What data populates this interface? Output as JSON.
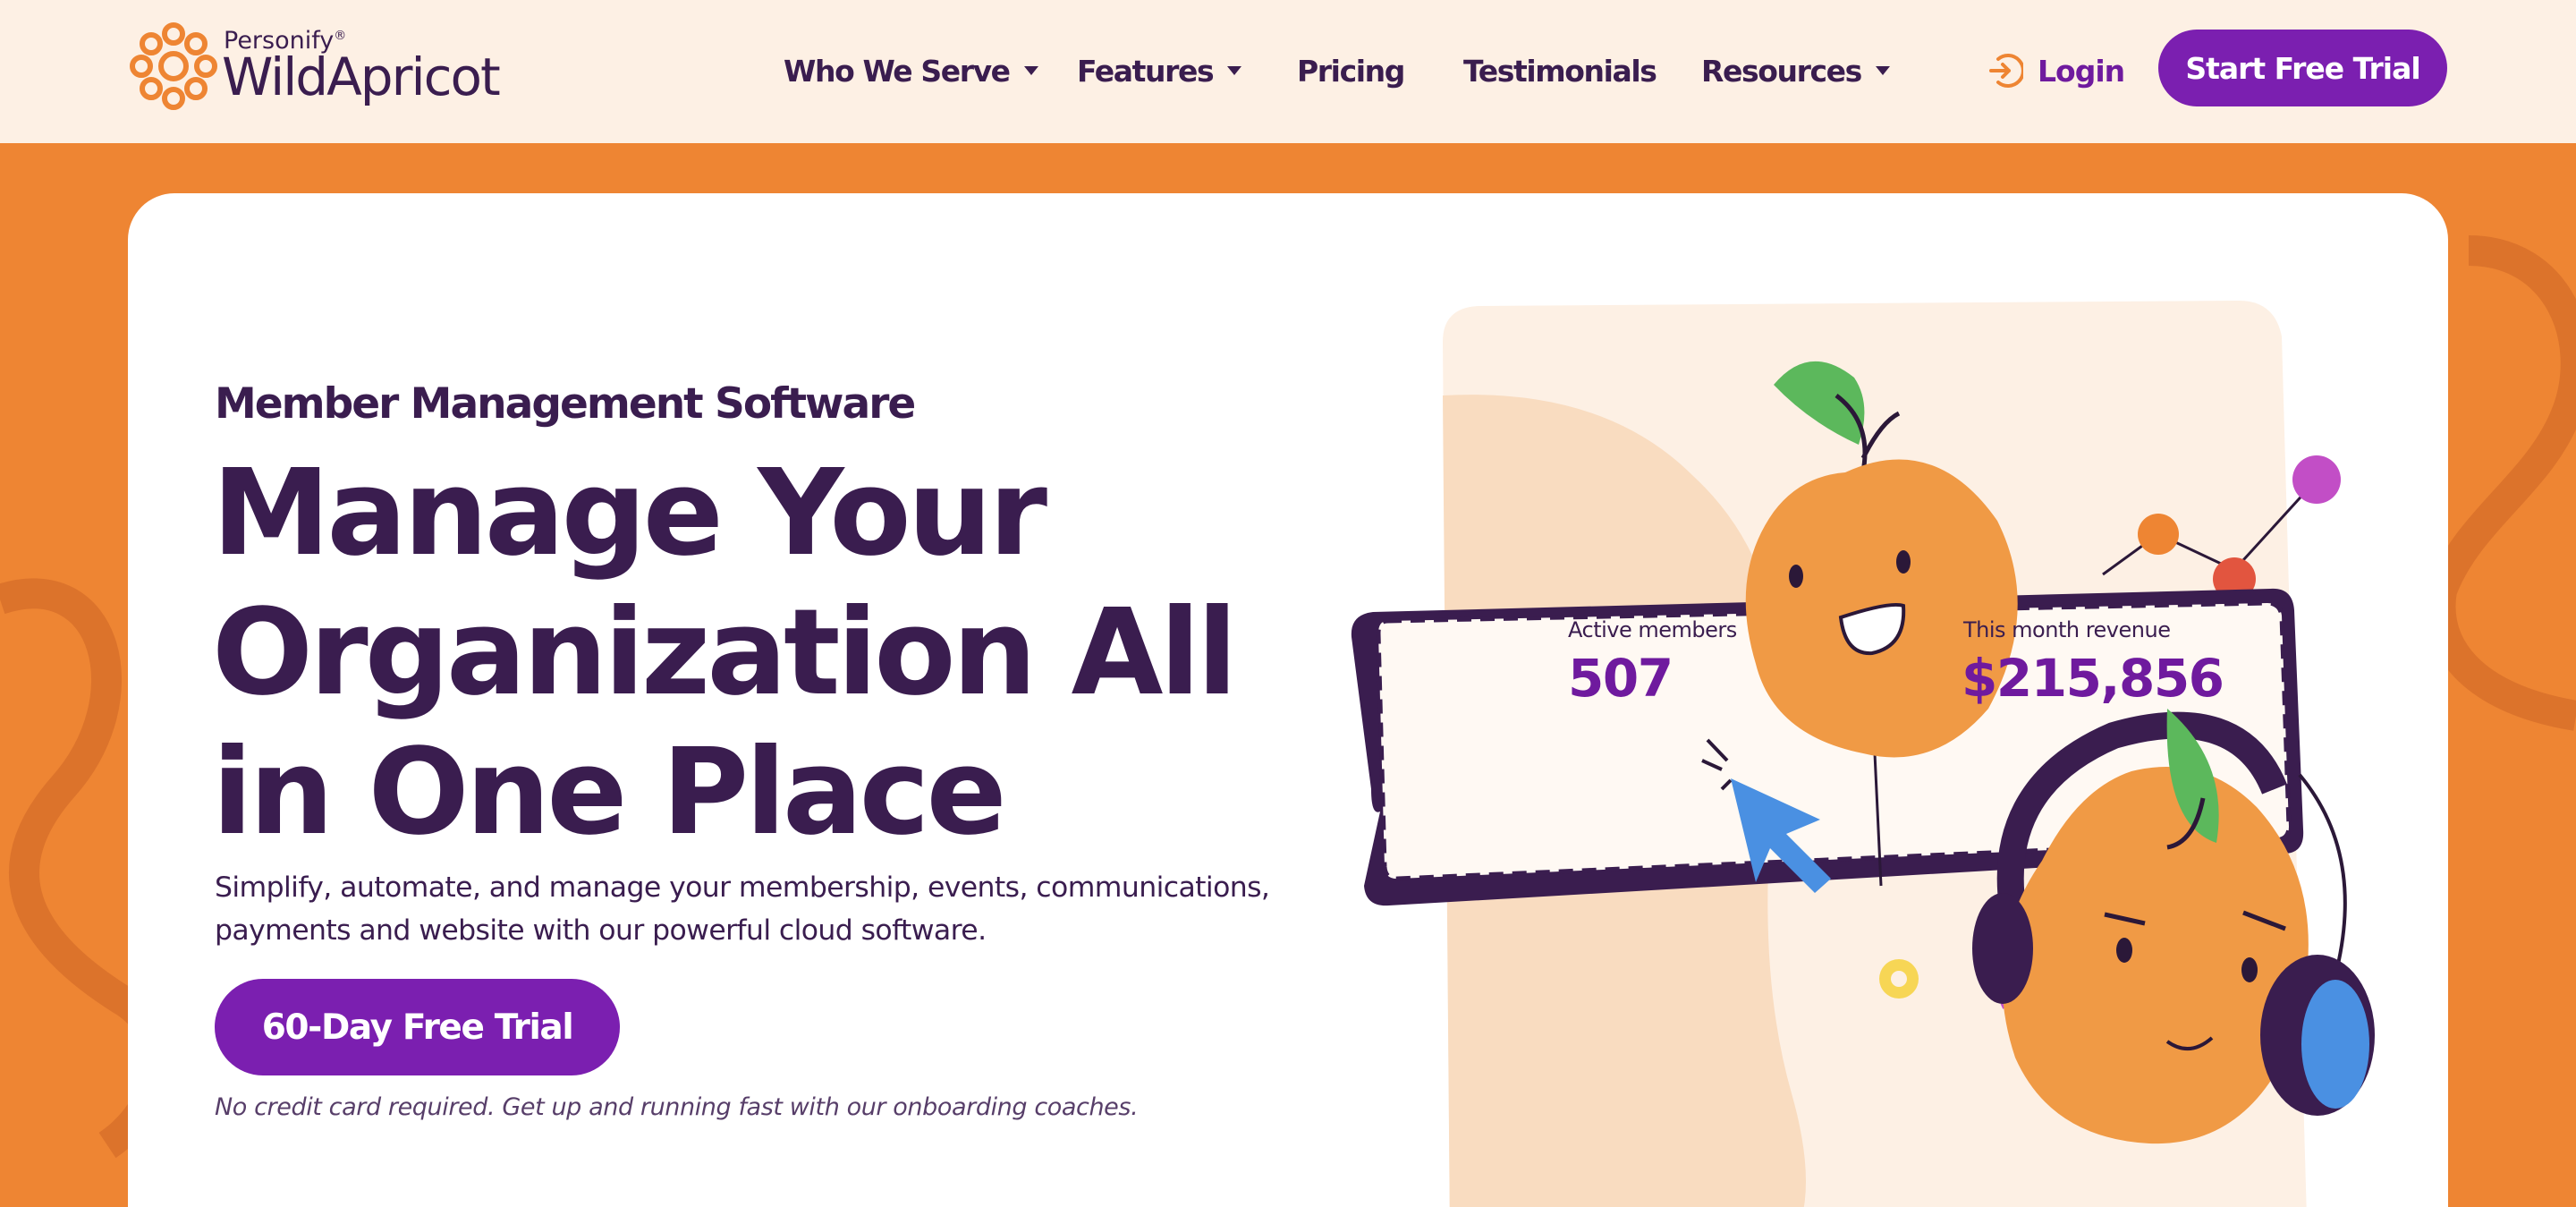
{
  "brand": {
    "parent_name": "Personify",
    "registered_mark": "®",
    "product_name": "WildApricot",
    "logo_icon": "sun-flower-icon",
    "colors": {
      "orange": "#ee8533",
      "purple_dark": "#3a1d4f",
      "purple_accent": "#7b1fb0",
      "cream": "#fdf0e4"
    }
  },
  "nav": {
    "items": [
      {
        "label": "Who We Serve",
        "has_dropdown": true
      },
      {
        "label": "Features",
        "has_dropdown": true
      },
      {
        "label": "Pricing",
        "has_dropdown": false
      },
      {
        "label": "Testimonials",
        "has_dropdown": false
      },
      {
        "label": "Resources",
        "has_dropdown": true
      }
    ],
    "login_label": "Login",
    "login_icon": "sign-in-icon",
    "cta_label": "Start Free Trial"
  },
  "hero": {
    "eyebrow": "Member Management Software",
    "headline_lines": [
      "Manage Your",
      "Organization All",
      "in One Place"
    ],
    "subtext_lines": [
      "Simplify, automate, and manage your membership, events, communications,",
      "payments and website with our powerful cloud software."
    ],
    "cta_label": "60-Day Free Trial",
    "note": "No credit card required. Get up and running fast with our onboarding coaches."
  },
  "illustration": {
    "stats": [
      {
        "label": "Active members",
        "value": "507"
      },
      {
        "label": "This month revenue",
        "value": "$215,856"
      }
    ]
  }
}
